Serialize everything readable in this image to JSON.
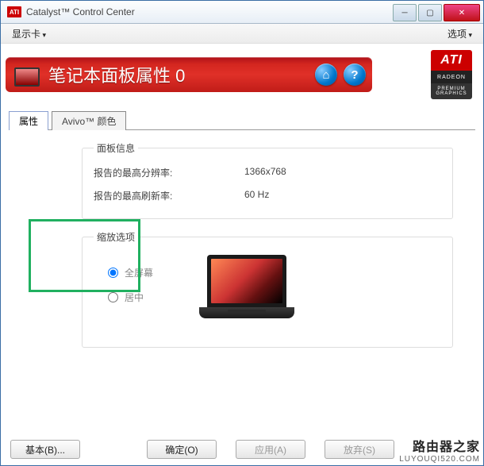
{
  "window": {
    "title": "Catalyst™ Control Center"
  },
  "menu": {
    "display_card": "显示卡",
    "options": "选项"
  },
  "header": {
    "title": "笔记本面板属性 0"
  },
  "brand": {
    "ati": "ATI",
    "radeon": "RADEON",
    "premium": "PREMIUM",
    "graphics": "GRAPHICS"
  },
  "tabs": [
    {
      "label": "属性",
      "active": true
    },
    {
      "label": "Avivo™ 颜色",
      "active": false
    }
  ],
  "panel_info": {
    "legend": "面板信息",
    "max_resolution_label": "报告的最高分辨率:",
    "max_resolution_value": "1366x768",
    "max_refresh_label": "报告的最高刷新率:",
    "max_refresh_value": "60 Hz"
  },
  "scaling": {
    "legend": "缩放选项",
    "options": [
      "全屏幕",
      "居中"
    ],
    "selected_index": 0
  },
  "footer": {
    "basic": "基本(B)...",
    "ok": "确定(O)",
    "apply": "应用(A)",
    "discard": "放弃(S)"
  },
  "watermark": {
    "line1": "路由器之家",
    "line2": "LUYOUQI520.COM"
  }
}
